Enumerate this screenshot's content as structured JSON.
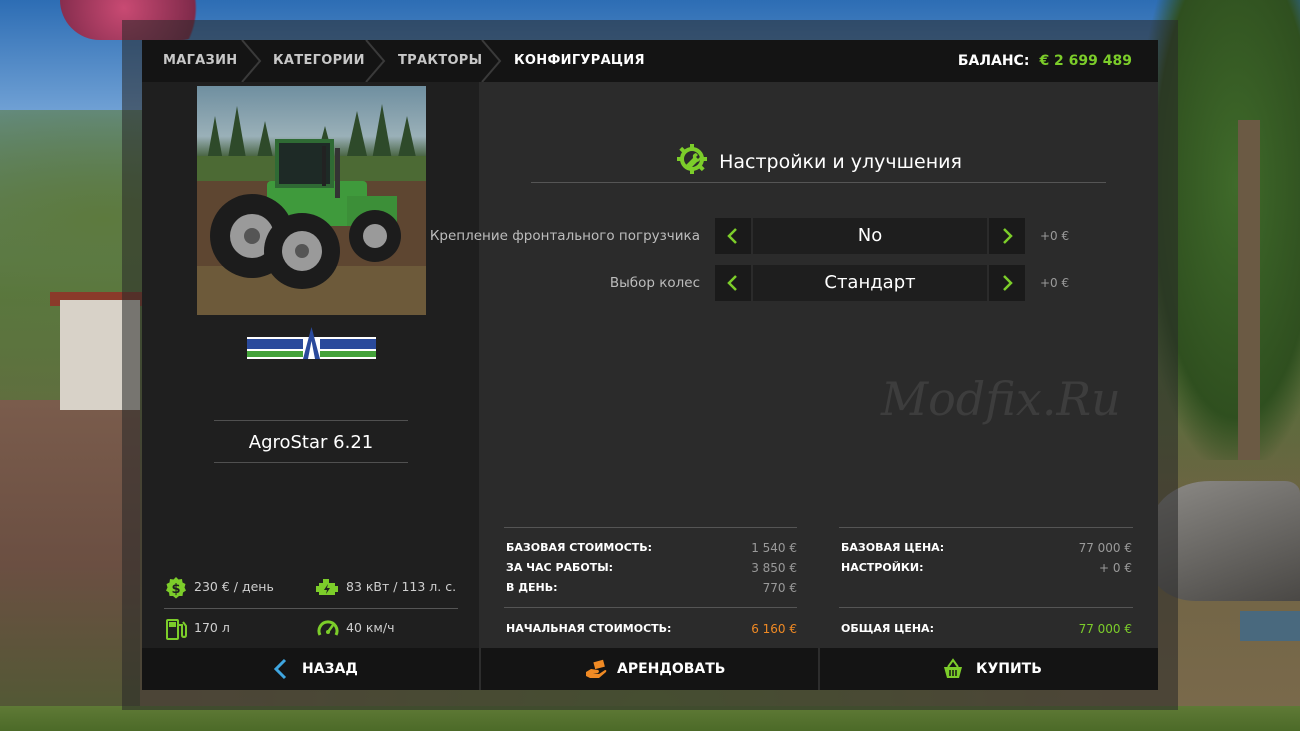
{
  "breadcrumb": [
    {
      "label": "МАГАЗИН"
    },
    {
      "label": "КАТЕГОРИИ"
    },
    {
      "label": "ТРАКТОРЫ"
    },
    {
      "label": "КОНФИГУРАЦИЯ"
    }
  ],
  "balance": {
    "label": "БАЛАНС:",
    "amount": "€ 2 699 489"
  },
  "vehicle": {
    "brand_left": "DEUTZ",
    "brand_right": "FAHR",
    "model": "AgroStar 6.21"
  },
  "stats": {
    "daily_cost": "230 € / день",
    "power": "83 кВт / 113 л. с.",
    "fuel": "170 л",
    "speed": "40 км/ч"
  },
  "config": {
    "title": "Настройки и улучшения",
    "options": [
      {
        "label": "Крепление фронтального погрузчика",
        "value": "No",
        "price": "+0 €"
      },
      {
        "label": "Выбор колес",
        "value": "Стандарт",
        "price": "+0 €"
      }
    ]
  },
  "watermark": "Modfix.Ru",
  "costs": {
    "base_cost_label": "БАЗОВАЯ СТОИМОСТЬ:",
    "base_cost_value": "1 540 €",
    "per_hour_label": "ЗА ЧАС РАБОТЫ:",
    "per_hour_value": "3 850 €",
    "per_day_label": "В ДЕНЬ:",
    "per_day_value": "770 €",
    "initial_cost_label": "НАЧАЛЬНАЯ СТОИМОСТЬ:",
    "initial_cost_value": "6 160 €",
    "base_price_label": "БАЗОВАЯ ЦЕНА:",
    "base_price_value": "77 000 €",
    "settings_label": "НАСТРОЙКИ:",
    "settings_value": "+ 0 €",
    "total_label": "ОБЩАЯ ЦЕНА:",
    "total_value": "77 000 €"
  },
  "actions": {
    "back": "НАЗАД",
    "lease": "АРЕНДОВАТЬ",
    "buy": "КУПИТЬ"
  },
  "colors": {
    "accent_green": "#7ccd2a",
    "accent_orange": "#f08a24",
    "panel_dark": "#1f1f1f",
    "bar_dark": "#141414"
  }
}
